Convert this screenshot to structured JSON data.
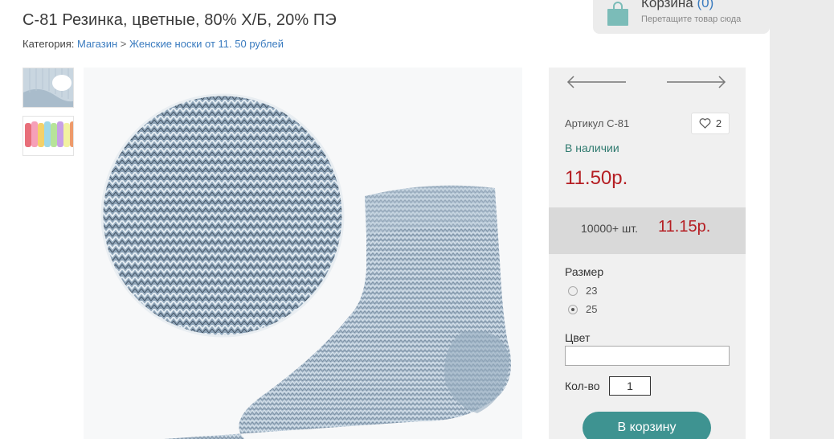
{
  "product": {
    "title": "С-81 Резинка, цветные, 80% Х/Б, 20% ПЭ"
  },
  "breadcrumb": {
    "prefix": "Категория:",
    "link1": "Магазин",
    "separator": ">",
    "link2": "Женские носки от 11. 50 рублей"
  },
  "cart": {
    "title": "Корзина",
    "count": "(0)",
    "hint": "Перетащите товар сюда"
  },
  "details": {
    "article": "Артикул С-81",
    "likes": "2",
    "availability": "В наличии",
    "price": "11.50р.",
    "bulk_qty": "10000+ шт.",
    "bulk_price": "11.15р.",
    "size_label": "Размер",
    "sizes": [
      "23",
      "25"
    ],
    "selected_size": "25",
    "color_label": "Цвет",
    "color_value": "",
    "qty_label": "Кол-во",
    "qty_value": "1",
    "add_to_cart": "В корзину"
  },
  "colors": {
    "price": "#b51e23",
    "stock": "#2f7a6f",
    "link": "#3a7bbf",
    "button": "#3e9391",
    "cart_bag": "#7bbcb8"
  },
  "icons": [
    "shopping-bag-icon",
    "heart-icon",
    "arrow-left-icon",
    "arrow-right-icon"
  ]
}
